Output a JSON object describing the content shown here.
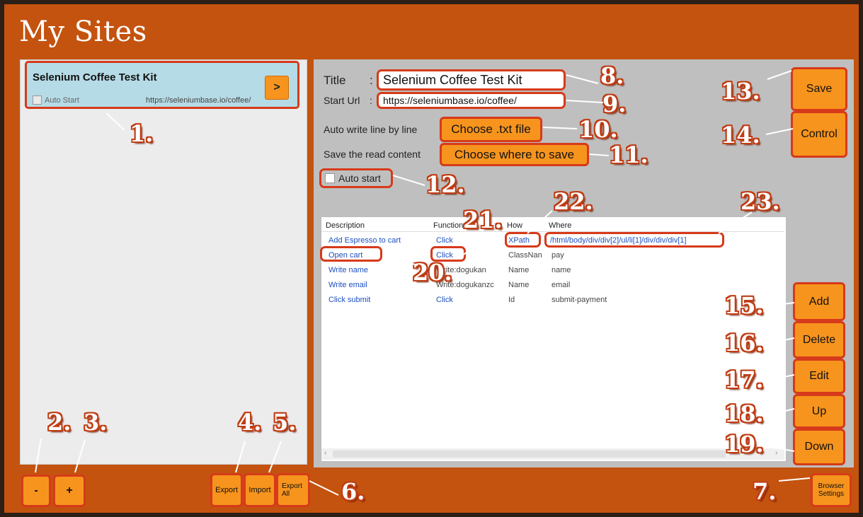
{
  "window": {
    "title": "My Sites"
  },
  "sites": [
    {
      "title": "Selenium Coffee Test Kit",
      "auto_start_label": "Auto Start",
      "url": "https://seleniumbase.io/coffee/",
      "go_label": ">"
    }
  ],
  "form": {
    "title_label": "Title",
    "title_sep": ":",
    "title_value": "Selenium Coffee Test Kit",
    "url_label": "Start Url",
    "url_sep": ":",
    "url_value": "https://seleniumbase.io/coffee/",
    "autowrite_label": "Auto write line by line",
    "autowrite_button": "Choose .txt file",
    "save_read_label": "Save the read content",
    "save_read_button": "Choose where to save",
    "auto_start_label": "Auto start"
  },
  "table": {
    "columns": [
      "Description",
      "Function",
      "How",
      "Where"
    ],
    "rows": [
      {
        "description": "Add Espresso to cart",
        "function": "Click",
        "how": "XPath",
        "where": "/html/body/div/div[2]/ul/li[1]/div/div/div[1]"
      },
      {
        "description": "Open cart",
        "function": "Click",
        "how": "ClassNan",
        "where": "pay"
      },
      {
        "description": "Write name",
        "function": "Write:dogukan",
        "how": "Name",
        "where": "name"
      },
      {
        "description": "Write email",
        "function": "Write:dogukanzc",
        "how": "Name",
        "where": "email"
      },
      {
        "description": "Click submit",
        "function": "Click",
        "how": "Id",
        "where": "submit-payment"
      }
    ]
  },
  "buttons": {
    "save": "Save",
    "control": "Control",
    "add": "Add",
    "delete": "Delete",
    "edit": "Edit",
    "up": "Up",
    "down": "Down",
    "minus": "-",
    "plus": "+",
    "export": "Export",
    "import": "Import",
    "export_all": "Export All",
    "browser_settings": "Browser Settings"
  },
  "callouts": [
    "1.",
    "2.",
    "3.",
    "4.",
    "5.",
    "6.",
    "7.",
    "8.",
    "9.",
    "10.",
    "11.",
    "12.",
    "13.",
    "14.",
    "15.",
    "16.",
    "17.",
    "18.",
    "19.",
    "20.",
    "21.",
    "22.",
    "23."
  ],
  "colors": {
    "frame": "#c4530f",
    "accent_button": "#f7941d",
    "highlight_ring": "#d63a1a",
    "selected_item": "#b5dbe6",
    "link_text": "#1c4fbf"
  }
}
